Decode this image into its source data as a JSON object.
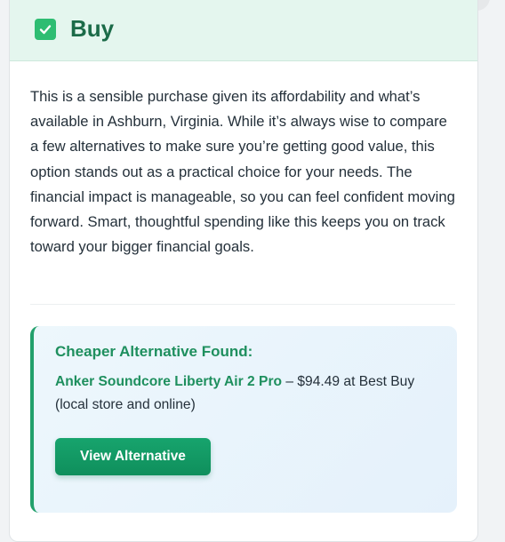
{
  "verdict": {
    "label": "Buy",
    "icon": "check-box-icon",
    "accent_color": "#2ebd72",
    "header_bg": "#e4f6ee"
  },
  "explanation": "This is a sensible purchase given its affordability and what’s available in Ashburn, Virginia. While it’s always wise to compare a few alternatives to make sure you’re getting good value, this option stands out as a practical choice for your needs. The financial impact is manageable, so you can feel confident moving forward. Smart, thoughtful spending like this keeps you on track toward your bigger financial goals.",
  "alternative": {
    "title": "Cheaper Alternative Found:",
    "product_name": "Anker Soundcore Liberty Air 2 Pro",
    "details": " – $94.49 at Best Buy (local store and online)",
    "button_label": "View Alternative",
    "accent_color": "#22a06b"
  }
}
